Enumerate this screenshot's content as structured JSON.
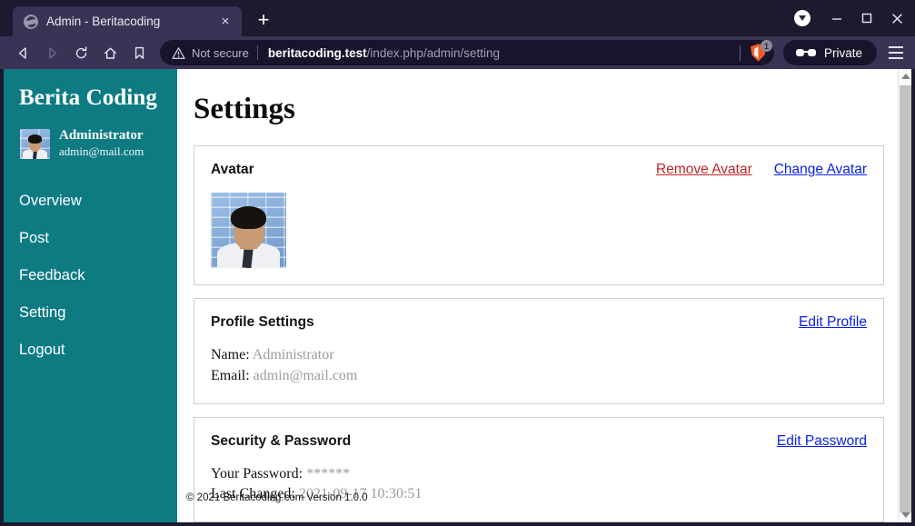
{
  "browser": {
    "tab": {
      "title": "Admin - Beritacoding",
      "favicon": "globe-icon",
      "close": "×"
    },
    "new_tab": "+",
    "window_controls": {
      "minimize": "–",
      "maximize": "□",
      "close": "✕"
    },
    "download_indicator": "download-icon",
    "nav": {
      "back": "back-arrow-icon",
      "forward": "forward-arrow-icon",
      "reload": "reload-icon",
      "home": "home-icon",
      "bookmark": "bookmark-icon"
    },
    "address": {
      "security_icon": "warning-triangle-icon",
      "security_label": "Not secure",
      "url_host": "beritacoding.test",
      "url_path": "/index.php/admin/setting",
      "url_full": "beritacoding.test/index.php/admin/setting"
    },
    "shield": {
      "icon": "brave-shield-icon",
      "count": "1"
    },
    "private_button": {
      "label": "Private",
      "icon": "sunglasses-icon"
    },
    "menu_button": "hamburger-menu-icon"
  },
  "sidebar": {
    "brand": "Berita Coding",
    "user": {
      "name": "Administrator",
      "email": "admin@mail.com",
      "avatar": "user-photo"
    },
    "items": [
      {
        "label": "Overview"
      },
      {
        "label": "Post"
      },
      {
        "label": "Feedback"
      },
      {
        "label": "Setting"
      },
      {
        "label": "Logout"
      }
    ]
  },
  "page": {
    "title": "Settings",
    "footer": "© 2021 Beritacoding.com Version 1.0.0",
    "cards": {
      "avatar": {
        "title": "Avatar",
        "remove_link": "Remove Avatar",
        "change_link": "Change Avatar",
        "image": "user-photo"
      },
      "profile": {
        "title": "Profile Settings",
        "edit_link": "Edit Profile",
        "name_label": "Name:",
        "name_value": "Administrator",
        "email_label": "Email:",
        "email_value": "admin@mail.com"
      },
      "security": {
        "title": "Security & Password",
        "edit_link": "Edit Password",
        "password_label": "Your Password:",
        "password_value": "******",
        "changed_label": "Last Changed:",
        "changed_value": "2021-09-17 10:30:51"
      }
    }
  },
  "colors": {
    "sidebar": "#0e7b83",
    "chrome_titlebar": "#1c1a2e",
    "chrome_toolbar": "#3b3356",
    "urlbar": "#17142b",
    "link_blue": "#0b21e8",
    "link_red": "#c32525"
  },
  "scrollbar": {
    "up": "scroll-up-arrow",
    "down": "scroll-down-arrow"
  }
}
